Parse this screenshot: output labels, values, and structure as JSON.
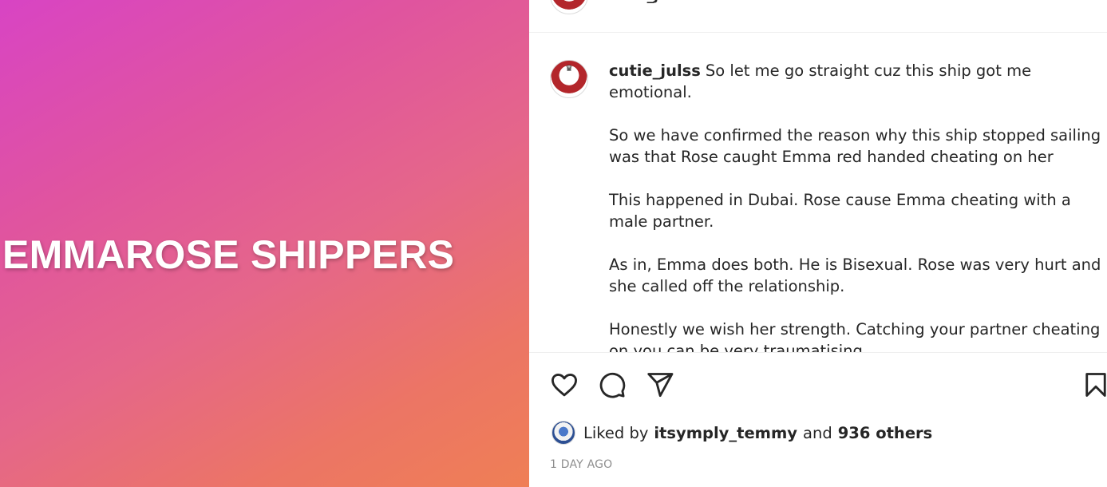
{
  "post": {
    "image_text": "EMMAROSE SHIPPERS",
    "author": "cutie_julss",
    "caption": {
      "username": "cutie_julss",
      "paragraphs": [
        "So let me go straight cuz this ship got me emotional.",
        "So we have confirmed the reason why this ship stopped sailing was that Rose caught Emma red handed cheating on her",
        "This happened in Dubai. Rose cause Emma cheating with a male partner.",
        "As in, Emma does both. He is Bisexual. Rose was very hurt and she called off the relationship.",
        "Honestly we wish her strength. Catching your partner cheating on you can be very traumatising."
      ]
    },
    "likes": {
      "prefix": "Liked by",
      "user": "itsymply_temmy",
      "joiner": "and",
      "others": "936 others"
    },
    "timestamp": "1 DAY AGO"
  },
  "icons": {
    "like": "heart-icon",
    "comment": "comment-icon",
    "share": "send-icon",
    "save": "bookmark-icon"
  }
}
